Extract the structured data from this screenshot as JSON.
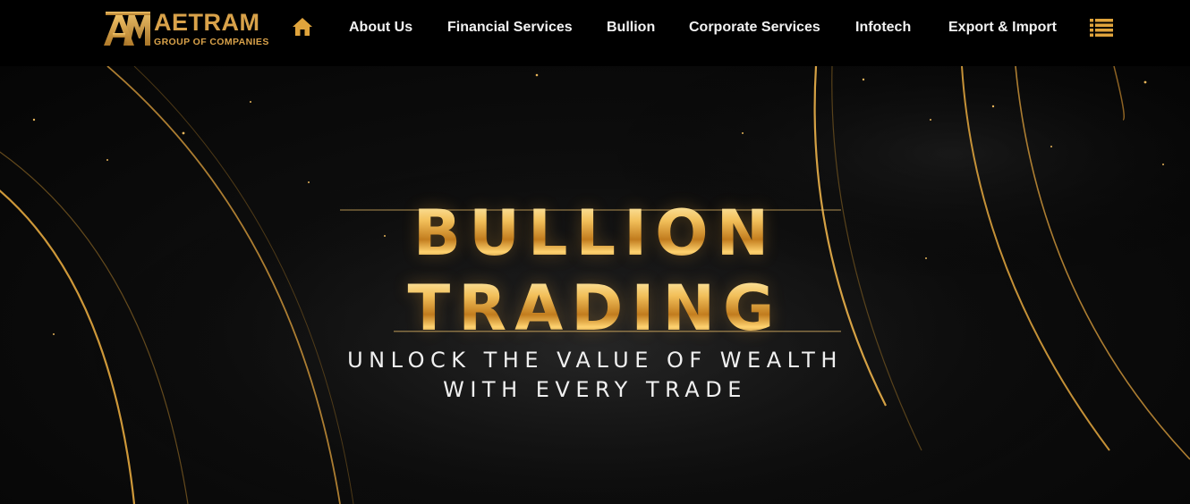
{
  "brand": {
    "name": "AETRAM",
    "tagline": "GROUP OF COMPANIES",
    "accent_color": "#d9a24a"
  },
  "header": {
    "home_icon": "home-icon",
    "menu_icon": "list-menu-icon",
    "nav": [
      {
        "label": "About Us"
      },
      {
        "label": "Financial Services"
      },
      {
        "label": "Bullion"
      },
      {
        "label": "Corporate Services"
      },
      {
        "label": "Infotech"
      },
      {
        "label": "Export & Import"
      }
    ]
  },
  "hero": {
    "title_line1": "BULLION",
    "title_line2": "TRADING",
    "subtitle_line1": "UNLOCK THE VALUE OF WEALTH",
    "subtitle_line2": "WITH EVERY TRADE"
  }
}
